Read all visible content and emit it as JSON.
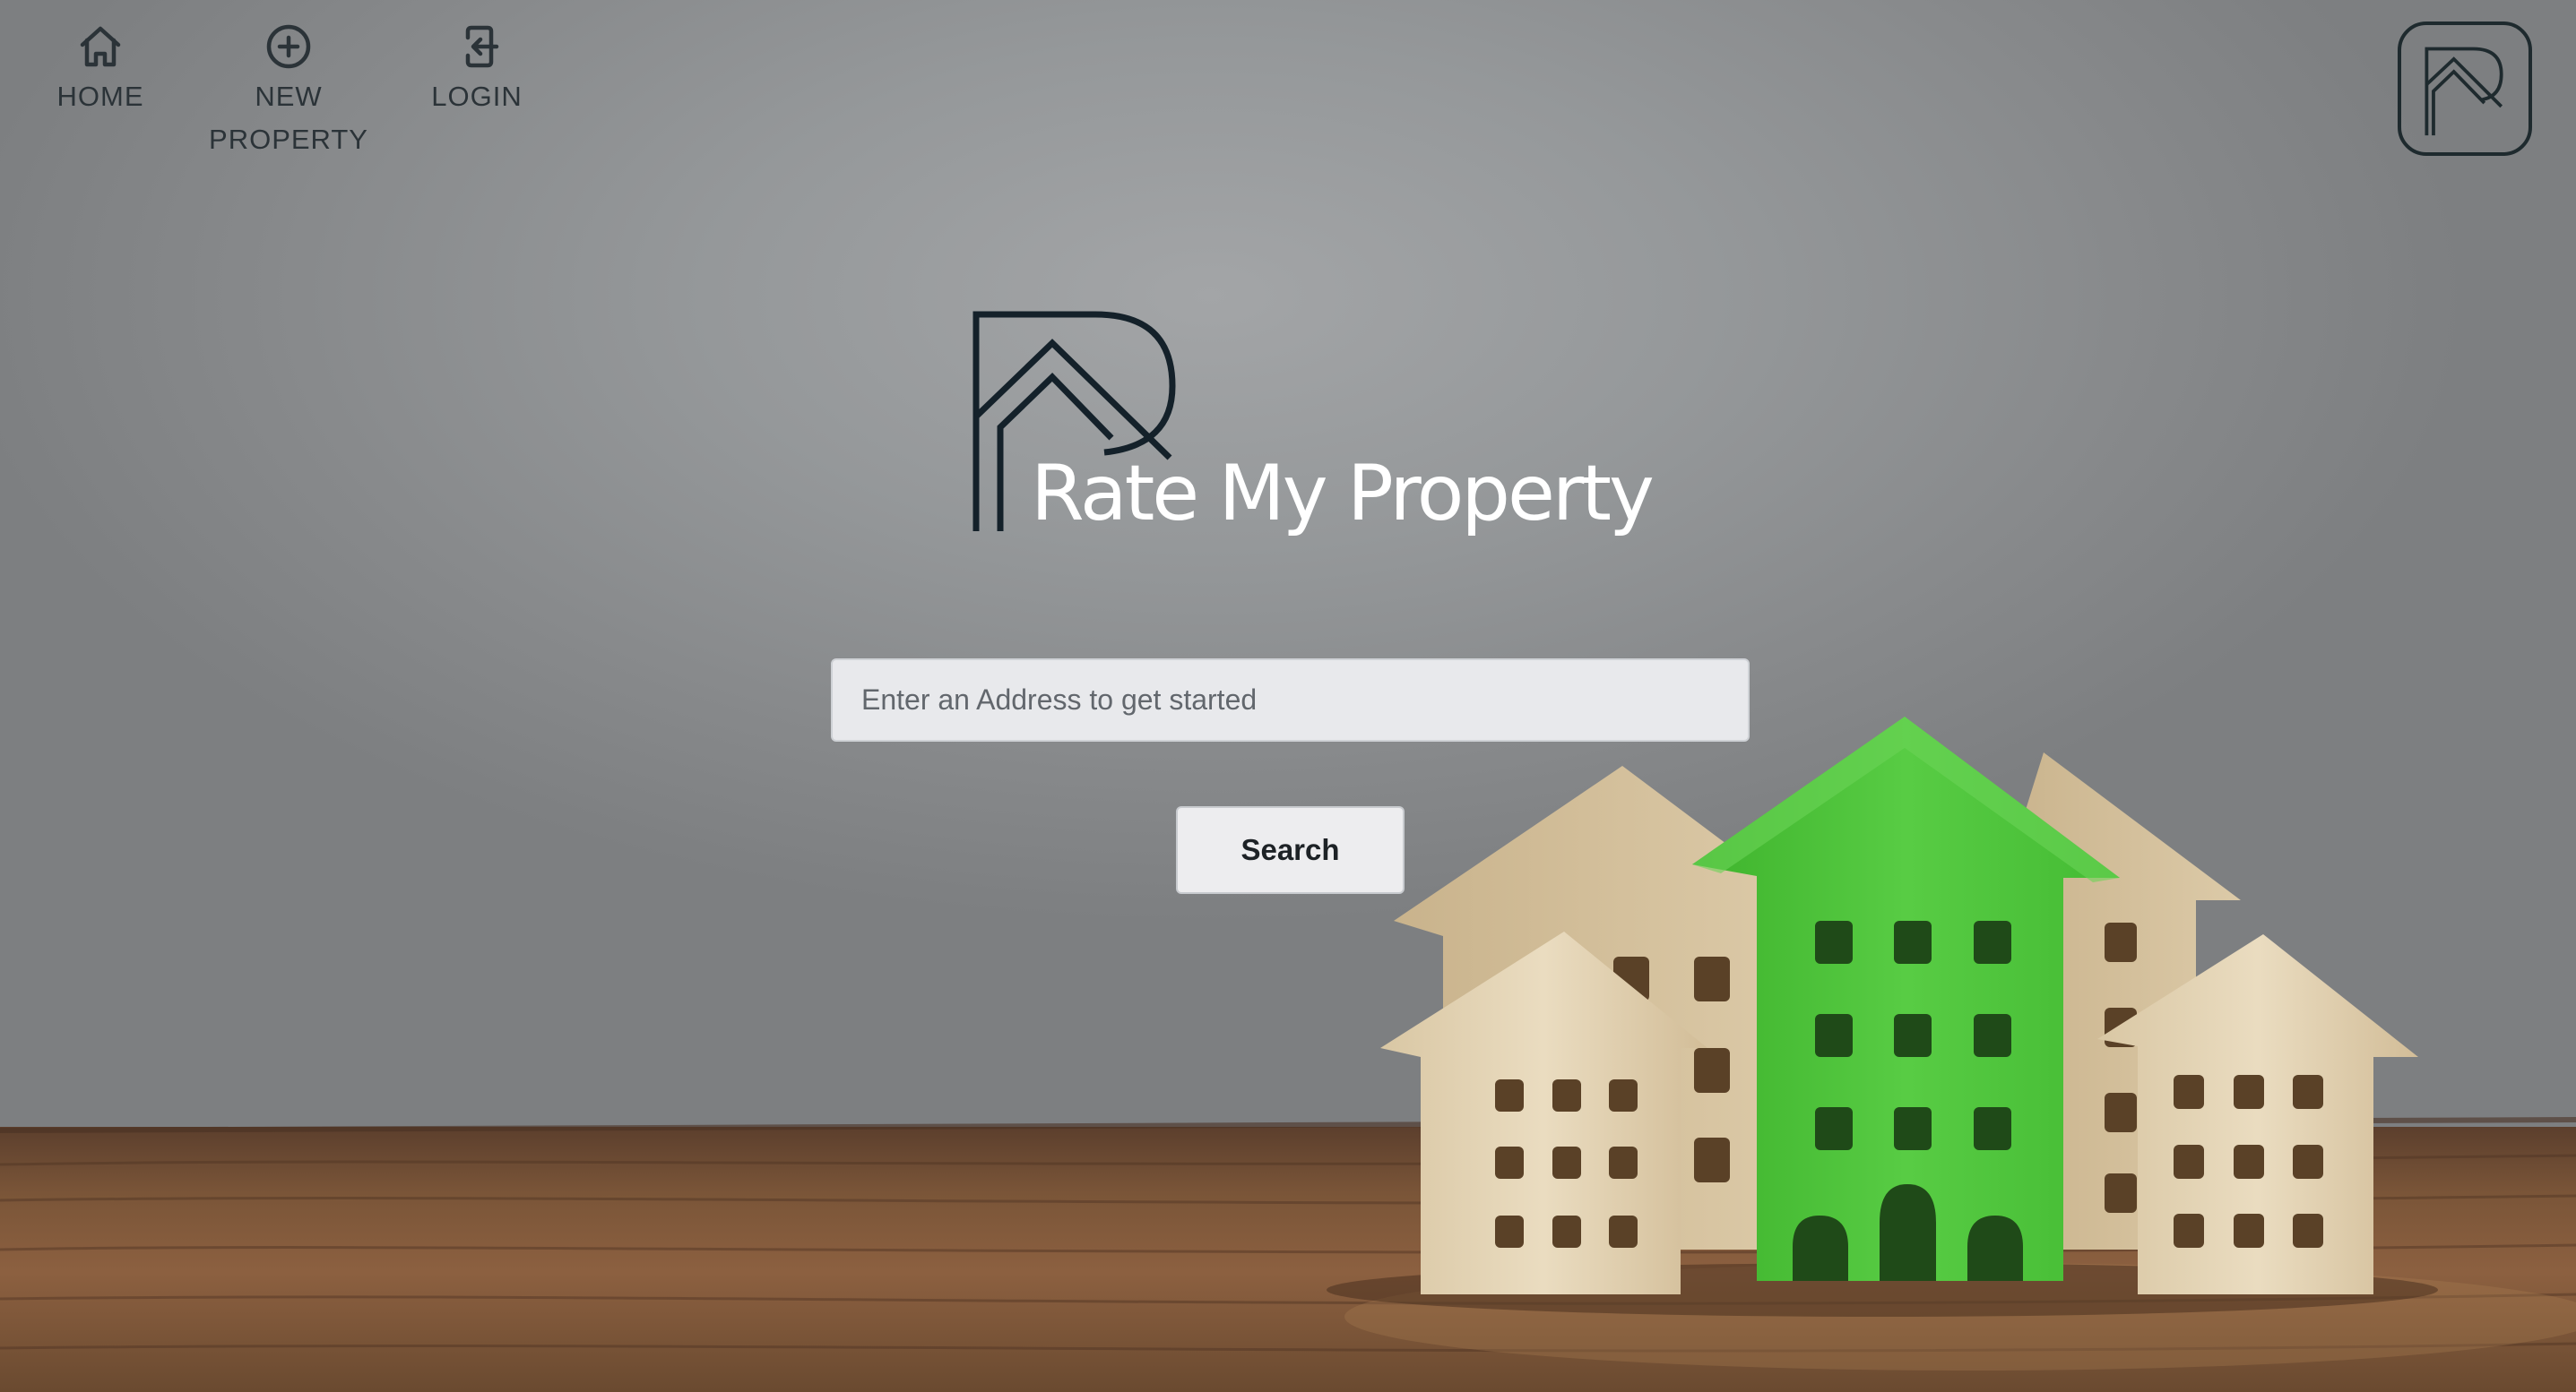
{
  "nav": {
    "items": [
      {
        "label": "HOME",
        "icon": "home-icon"
      },
      {
        "label": "NEW PROPERTY",
        "icon": "plus-circle-icon"
      },
      {
        "label": "LOGIN",
        "icon": "login-icon"
      }
    ]
  },
  "brand": {
    "name": "Rate My Property",
    "logo_icon": "rmp-logo-icon"
  },
  "search": {
    "placeholder": "Enter an Address to get started",
    "value": "",
    "button_label": "Search"
  },
  "colors": {
    "nav_text": "#2b3338",
    "logo_stroke": "#1e2a2e",
    "brand_text": "#ffffff",
    "accent_green": "#4cc63a",
    "wood_light": "#e6d6b8",
    "table_wood": "#7a5538"
  }
}
